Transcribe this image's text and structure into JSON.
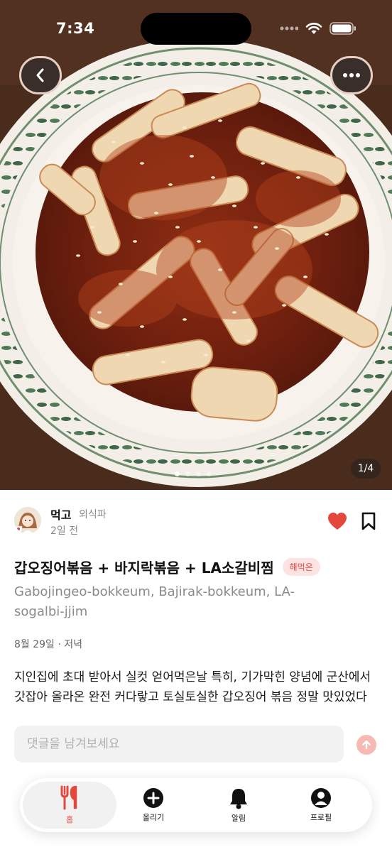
{
  "status_bar": {
    "time": "7:34"
  },
  "hero": {
    "image_description": "spicy stir-fried squid with sesame seeds on a patterned plate",
    "page_counter": "1/4",
    "current_page": 1,
    "total_pages": 4
  },
  "author": {
    "name": "먹고",
    "tag": "외식파",
    "time_ago": "2일 전"
  },
  "post": {
    "title": "갑오징어볶음 + 바지락볶음 + LA소갈비찜",
    "badge": "해먹은",
    "romanized": "Gabojingeo-bokkeum, Bajirak-bokkeum, LA-sogalbi-jjim",
    "meal_meta": "8월 29일 · 저녁",
    "body": "지인집에 초대 받아서 실컷 얻어먹은날 특히, 기가막힌 양념에 군산에서 갓잡아 올라온 완전 커다랗고 토실토실한 갑오징어 볶음 정말 맛있었다",
    "liked": true
  },
  "comment": {
    "placeholder": "댓글을 남겨보세요"
  },
  "tabs": [
    {
      "label": "홈",
      "icon": "fork-knife-icon",
      "active": true
    },
    {
      "label": "올리기",
      "icon": "plus-circle-icon",
      "active": false
    },
    {
      "label": "알림",
      "icon": "bell-icon",
      "active": false
    },
    {
      "label": "프로필",
      "icon": "profile-icon",
      "active": false
    }
  ],
  "colors": {
    "accent": "#e4473e",
    "badge_bg": "#fde4e2",
    "muted_text": "#8a8a8a",
    "input_bg": "#f2f2f2"
  }
}
